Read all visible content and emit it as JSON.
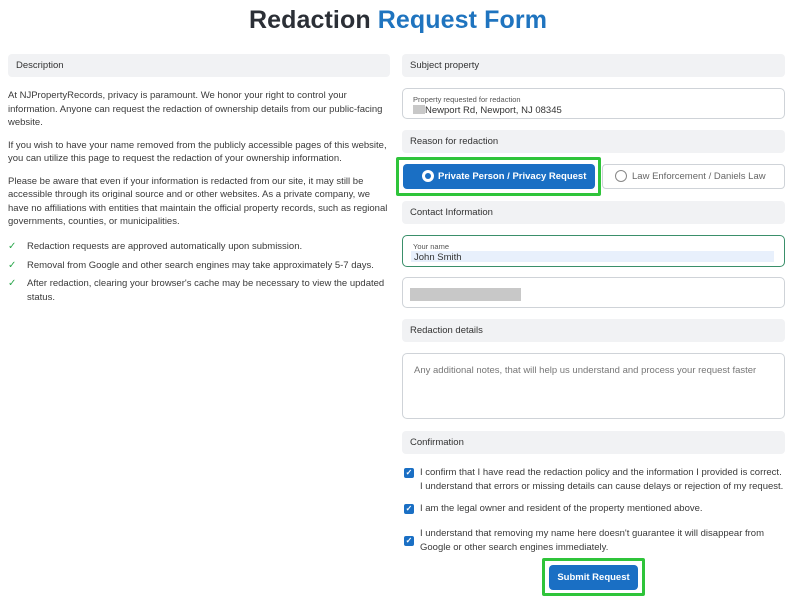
{
  "page": {
    "title_part1": "Redaction",
    "title_part2": "Request Form"
  },
  "description": {
    "heading": "Description",
    "paragraphs": [
      "At NJPropertyRecords, privacy is paramount. We honor your right to control your information. Anyone can request the redaction of ownership details from our public-facing website.",
      "If you wish to have your name removed from the publicly accessible pages of this website, you can utilize this page to request the redaction of your ownership information.",
      "Please be aware that even if your information is redacted from our site, it may still be accessible through its original source and or other websites. As a private company, we have no affiliations with entities that maintain the official property records, such as regional governments, counties, or municipalities."
    ],
    "checks": [
      "Redaction requests are approved automatically upon submission.",
      "Removal from Google and other search engines may take approximately 5-7 days.",
      "After redaction, clearing your browser's cache may be necessary to view the updated status."
    ]
  },
  "subject": {
    "heading": "Subject property",
    "field_label": "Property requested for redaction",
    "field_value": "Newport Rd, Newport, NJ 08345"
  },
  "reason": {
    "heading": "Reason for redaction",
    "option_private": "Private Person / Privacy Request",
    "option_law": "Law Enforcement / Daniels Law",
    "selected": "Private Person / Privacy Request"
  },
  "contact": {
    "heading": "Contact Information",
    "name_label": "Your name",
    "name_value": "John Smith"
  },
  "details": {
    "heading": "Redaction details",
    "placeholder": "Any additional notes, that will help us understand and process your request faster"
  },
  "confirmation": {
    "heading": "Confirmation",
    "items": [
      "I confirm that I have read the redaction policy and the information I provided is correct. I understand that errors or missing details can cause delays or rejection of my request.",
      "I am the legal owner and resident of the property mentioned above.",
      "I understand that removing my name here doesn't guarantee it will disappear from Google or other search engines immediately."
    ]
  },
  "submit": {
    "label": "Submit Request"
  },
  "colors": {
    "accent": "#1f74bf",
    "button": "#1a6fc4",
    "highlight": "#2fc43a",
    "check": "#2fa84f"
  }
}
